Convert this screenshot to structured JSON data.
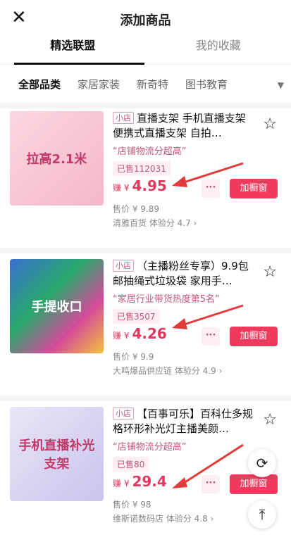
{
  "header": {
    "title": "添加商品",
    "close_icon": "close-icon"
  },
  "tabs": [
    "精选联盟",
    "我的收藏"
  ],
  "categories": [
    "全部品类",
    "家居家装",
    "新奇特",
    "图书教育"
  ],
  "products": [
    {
      "tag": "小店",
      "name": "直播支架 手机直播支架 便携式直播支架 自拍…",
      "highlight": "“店铺物流分超高”",
      "sold": "已售112031",
      "earn_label": "赚 ¥",
      "earn": "4.95",
      "price": "售价 ¥ 9.89",
      "shop": "清雅百货  体验分 4.7",
      "image_text": "拉高2.1米",
      "add_label": "加橱窗"
    },
    {
      "tag": "小店",
      "name": "（主播粉丝专享）9.9包邮抽绳式垃圾袋 家用手…",
      "highlight": "“家居行业带货热度第5名”",
      "sold": "已售3507",
      "earn_label": "赚 ¥",
      "earn": "4.26",
      "price": "售价 ¥ 9.9",
      "shop": "大鸣爆品供应链  体验分 4.9",
      "image_text": "手提收口",
      "add_label": "加橱窗"
    },
    {
      "tag": "小店",
      "name": "【百事可乐】百科仕多规格环形补光灯主播美颜…",
      "highlight": "“店铺物流分超高”",
      "sold": "已售80",
      "earn_label": "赚 ¥",
      "earn": "29.4",
      "price": "售价 ¥ 98",
      "shop": "维斯诺数码店  体验分 4.8",
      "image_text": "手机直播补光支架",
      "add_label": "加橱窗"
    }
  ],
  "colors": {
    "accent": "#ee3a5c",
    "tag": "#c0567e"
  }
}
